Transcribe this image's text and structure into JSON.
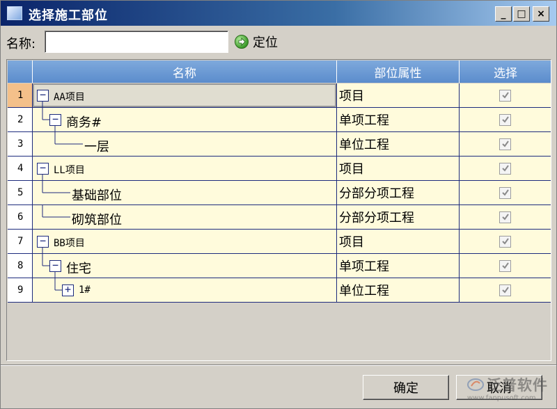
{
  "window": {
    "title": "选择施工部位",
    "controls": [
      "_",
      "□",
      "×"
    ]
  },
  "search": {
    "label": "名称:",
    "value": "",
    "placeholder": "",
    "locate_label": "定位"
  },
  "grid": {
    "columns": [
      "名称",
      "部位属性",
      "选择"
    ],
    "rows": [
      {
        "num": "1",
        "expander": "−",
        "name": "AA项目",
        "attr": "项目",
        "checked": true
      },
      {
        "num": "2",
        "expander": "−",
        "name": "商务#",
        "attr": "单项工程",
        "checked": true
      },
      {
        "num": "3",
        "expander": "",
        "name": "一层",
        "attr": "单位工程",
        "checked": true
      },
      {
        "num": "4",
        "expander": "−",
        "name": "LL项目",
        "attr": "项目",
        "checked": true
      },
      {
        "num": "5",
        "expander": "",
        "name": "基础部位",
        "attr": "分部分项工程",
        "checked": true
      },
      {
        "num": "6",
        "expander": "",
        "name": "砌筑部位",
        "attr": "分部分项工程",
        "checked": true
      },
      {
        "num": "7",
        "expander": "−",
        "name": "BB项目",
        "attr": "项目",
        "checked": true
      },
      {
        "num": "8",
        "expander": "−",
        "name": "住宅",
        "attr": "单项工程",
        "checked": true
      },
      {
        "num": "9",
        "expander": "+",
        "name": "1#",
        "attr": "单位工程",
        "checked": true
      }
    ]
  },
  "buttons": {
    "ok": "确定",
    "cancel": "取消"
  },
  "watermark": {
    "text": "泛普软件",
    "url": "www.fanpusoft.com"
  },
  "colors": {
    "title_gradient_start": "#0a246a",
    "header_blue": "#5b8ccc",
    "cell_bg": "#fffbdc",
    "grid_line": "#1c2a7c",
    "active_row": "#f4c08a"
  }
}
